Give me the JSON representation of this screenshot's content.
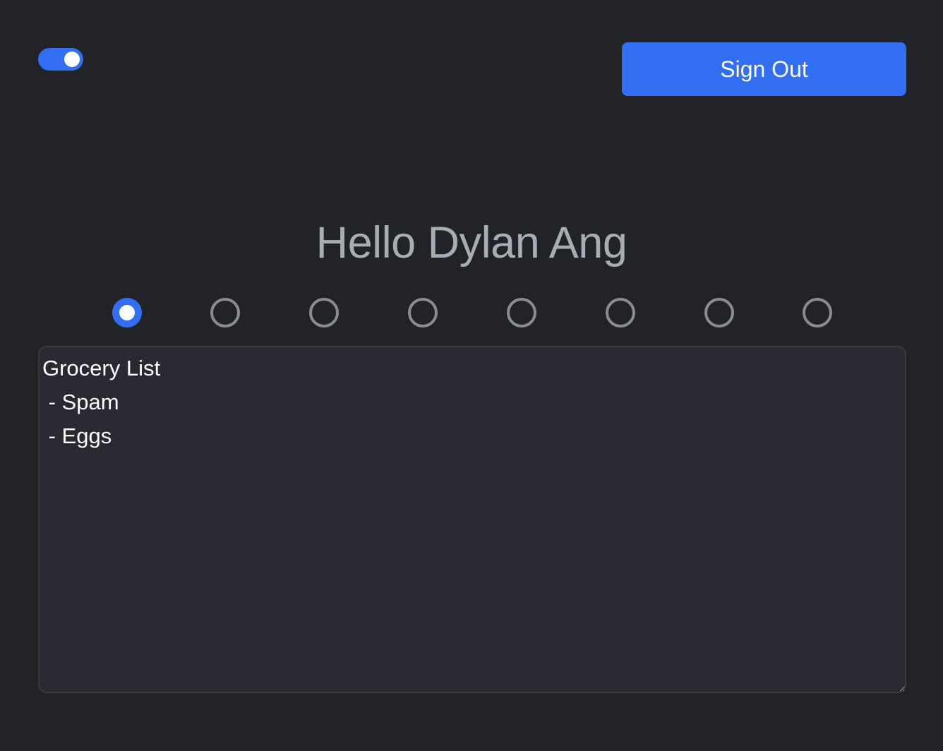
{
  "header": {
    "theme_toggle": {
      "state": "on",
      "accent": "#316ef1"
    },
    "signout_label": "Sign Out"
  },
  "main": {
    "greeting": "Hello Dylan Ang",
    "note_slots": {
      "count": 8,
      "selected_index": 0
    },
    "note_text": "Grocery List\n - Spam\n - Eggs"
  },
  "colors": {
    "background": "#212327",
    "accent": "#316ef1",
    "greeting_text": "#a8adb5",
    "textarea_bg": "#2a2933"
  }
}
